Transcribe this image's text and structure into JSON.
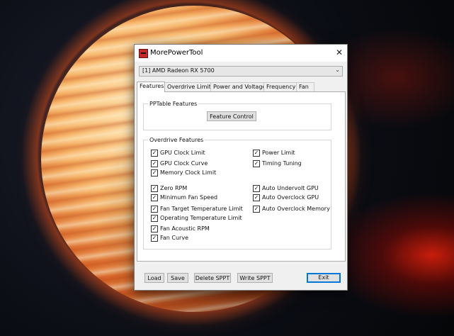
{
  "window": {
    "title": "MorePowerTool",
    "close_glyph": "✕",
    "icon": "app-icon",
    "gpu_select": {
      "value": "[1] AMD Radeon RX 5700",
      "chevron": "⌄"
    }
  },
  "tabs": [
    {
      "label": "Features",
      "active": true
    },
    {
      "label": "Overdrive Limits",
      "active": false
    },
    {
      "label": "Power and Voltage",
      "active": false
    },
    {
      "label": "Frequency",
      "active": false
    },
    {
      "label": "Fan",
      "active": false
    }
  ],
  "pptable": {
    "title": "PPTable Features",
    "button": "Feature Control"
  },
  "overdrive": {
    "title": "Overdrive Features",
    "check_glyph": "✓",
    "left": [
      {
        "label": "GPU Clock Limit",
        "checked": true
      },
      {
        "label": "GPU Clock Curve",
        "checked": true
      },
      {
        "label": "Memory Clock Limit",
        "checked": true
      },
      {
        "label": "Zero RPM",
        "checked": true
      },
      {
        "label": "Minimum Fan Speed",
        "checked": true
      },
      {
        "label": "Fan Target Temperature Limit",
        "checked": true
      },
      {
        "label": "Operating Temperature Limit",
        "checked": true
      },
      {
        "label": "Fan Acoustic RPM",
        "checked": true
      },
      {
        "label": "Fan Curve",
        "checked": true
      }
    ],
    "right": [
      {
        "label": "Power Limit",
        "checked": true
      },
      {
        "label": "Timing Tuning",
        "checked": true
      },
      {
        "label": "Auto Undervolt GPU",
        "checked": true
      },
      {
        "label": "Auto Overclock GPU",
        "checked": true
      },
      {
        "label": "Auto Overclock Memory",
        "checked": true
      }
    ]
  },
  "buttons": {
    "load": "Load",
    "save": "Save",
    "delete_sppt": "Delete SPPT",
    "write_sppt": "Write SPPT",
    "exit": "Exit"
  }
}
